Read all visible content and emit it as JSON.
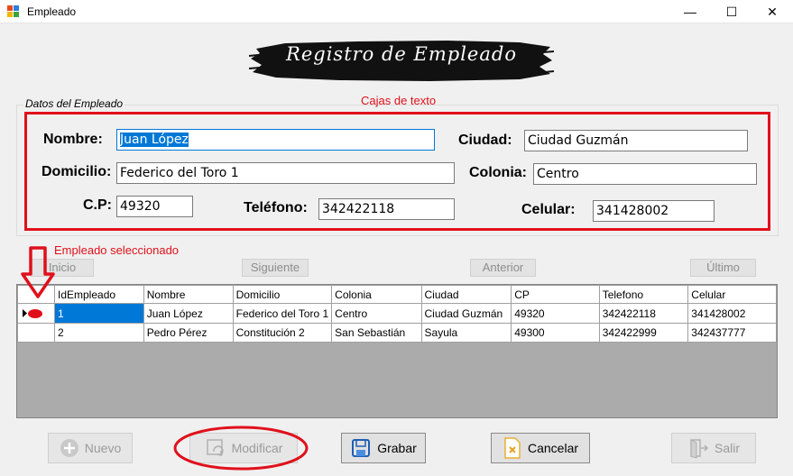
{
  "window": {
    "title": "Empleado",
    "minimize": "—",
    "maximize": "☐",
    "close": "✕"
  },
  "banner": {
    "text": "Registro de Empleado"
  },
  "group": {
    "legend": "Datos del Empleado"
  },
  "annotations": {
    "text_boxes": "Cajas de texto",
    "selected_employee": "Empleado seleccionado"
  },
  "form": {
    "nombre_label": "Nombre:",
    "nombre_value": "Juan López",
    "ciudad_label": "Ciudad:",
    "ciudad_value": "Ciudad Guzmán",
    "domicilio_label": "Domicilio:",
    "domicilio_value": "Federico del Toro 1",
    "colonia_label": "Colonia:",
    "colonia_value": "Centro",
    "cp_label": "C.P:",
    "cp_value": "49320",
    "telefono_label": "Teléfono:",
    "telefono_value": "342422118",
    "celular_label": "Celular:",
    "celular_value": "341428002"
  },
  "nav": {
    "inicio": "Inicio",
    "siguiente": "Siguiente",
    "anterior": "Anterior",
    "ultimo": "Último"
  },
  "grid": {
    "columns": [
      "IdEmpleado",
      "Nombre",
      "Domicilio",
      "Colonia",
      "Ciudad",
      "CP",
      "Telefono",
      "Celular"
    ],
    "rows": [
      [
        "1",
        "Juan López",
        "Federico del Toro 1",
        "Centro",
        "Ciudad Guzmán",
        "49320",
        "342422118",
        "341428002"
      ],
      [
        "2",
        "Pedro Pérez",
        "Constitución 2",
        "San Sebastián",
        "Sayula",
        "49300",
        "342422999",
        "342437777"
      ]
    ],
    "selected_row": 0
  },
  "buttons": {
    "nuevo": "Nuevo",
    "modificar": "Modificar",
    "grabar": "Grabar",
    "cancelar": "Cancelar",
    "salir": "Salir"
  },
  "colors": {
    "annotation_red": "#e0101b",
    "selection_blue": "#0078d7"
  }
}
